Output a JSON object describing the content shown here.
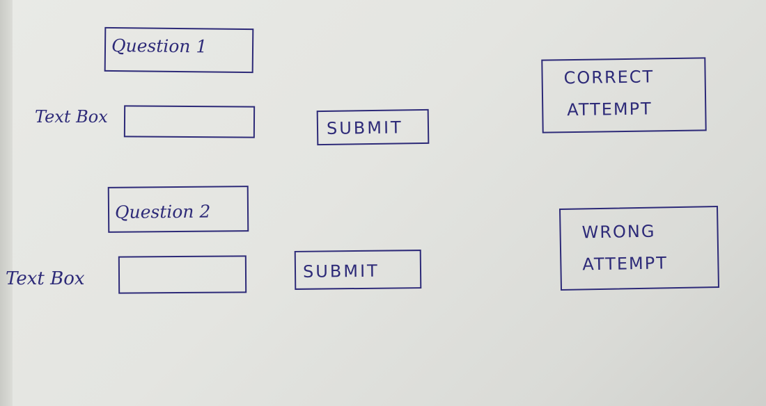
{
  "questions": [
    {
      "title": "Question 1",
      "input_label": "Text Box",
      "input_value": "",
      "submit_label": "SUBMIT"
    },
    {
      "title": "Question 2",
      "input_label": "Text Box",
      "input_value": "",
      "submit_label": "SUBMIT"
    }
  ],
  "results": {
    "correct": {
      "line1": "CORRECT",
      "line2": "ATTEMPT"
    },
    "wrong": {
      "line1": "WRONG",
      "line2": "ATTEMPT"
    }
  },
  "colors": {
    "ink": "#2d2a78",
    "paper": "#e4e5e1"
  }
}
